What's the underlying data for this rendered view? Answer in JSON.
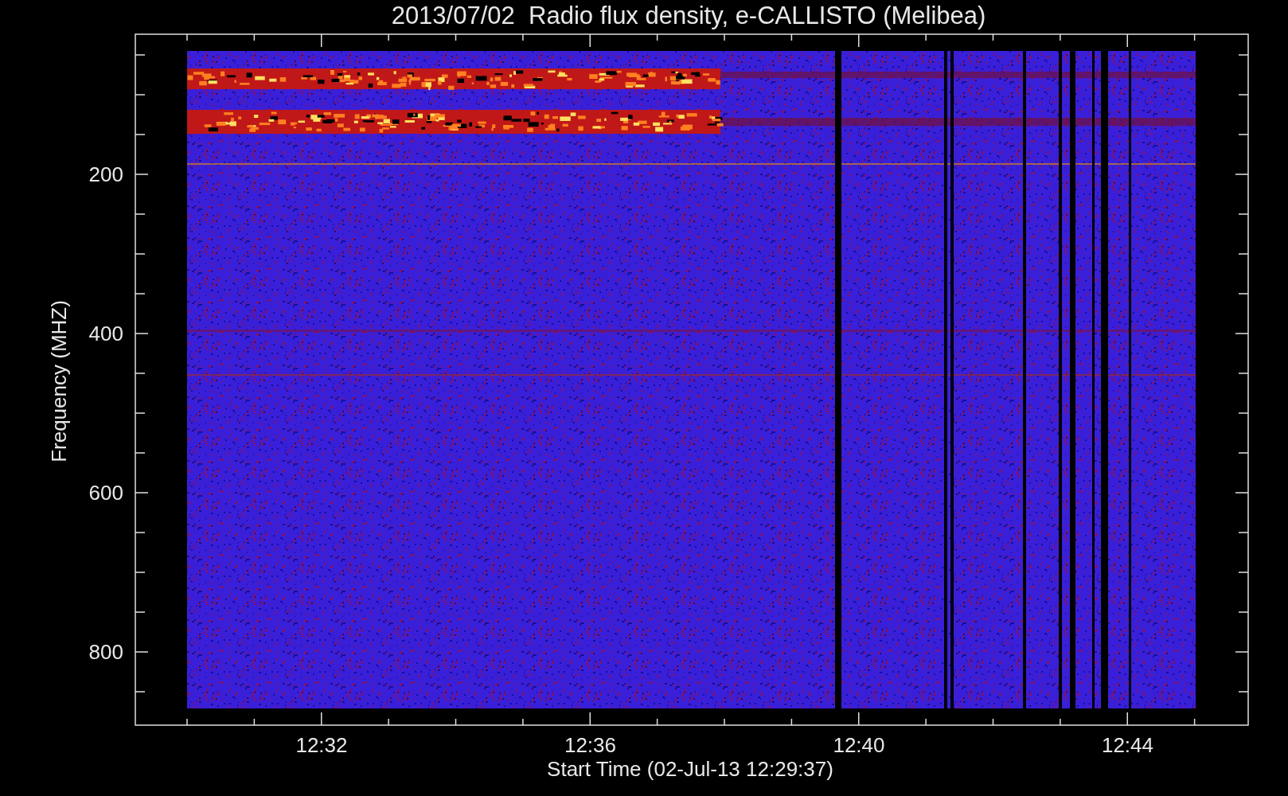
{
  "chart": {
    "title": "2013/07/02  Radio flux density, e-CALLISTO (Melibea)",
    "y_axis": {
      "label": "Frequency (MHZ)",
      "ticks": [
        "200",
        "400",
        "600",
        "800"
      ]
    },
    "x_axis": {
      "label": "Start Time (02-Jul-13 12:29:37)",
      "ticks": [
        "12:32",
        "12:36",
        "12:40",
        "12:44"
      ]
    }
  }
}
